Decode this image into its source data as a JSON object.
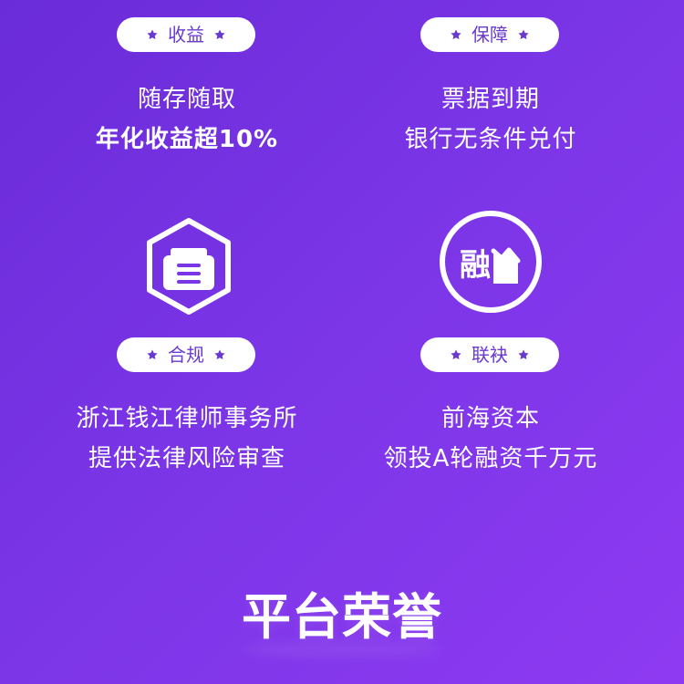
{
  "features": [
    {
      "pill": "收益",
      "lines": [
        "随存随取",
        "年化收益超10%"
      ]
    },
    {
      "pill": "保障",
      "lines": [
        "票据到期",
        "银行无条件兑付"
      ]
    },
    {
      "pill": "合规",
      "lines": [
        "浙江钱江律师事务所",
        "提供法律风险审查"
      ]
    },
    {
      "pill": "联袂",
      "lines": [
        "前海资本",
        "领投A轮融资千万元"
      ]
    }
  ],
  "icons": {
    "compliance": "briefcase-icon",
    "finance": "rong-financing-icon",
    "rong_char": "融"
  },
  "footer": {
    "title": "平台荣誉"
  },
  "colors": {
    "background_start": "#6a2bd8",
    "background_end": "#8e3af2",
    "pill_text": "#6a39cf",
    "white": "#ffffff"
  }
}
